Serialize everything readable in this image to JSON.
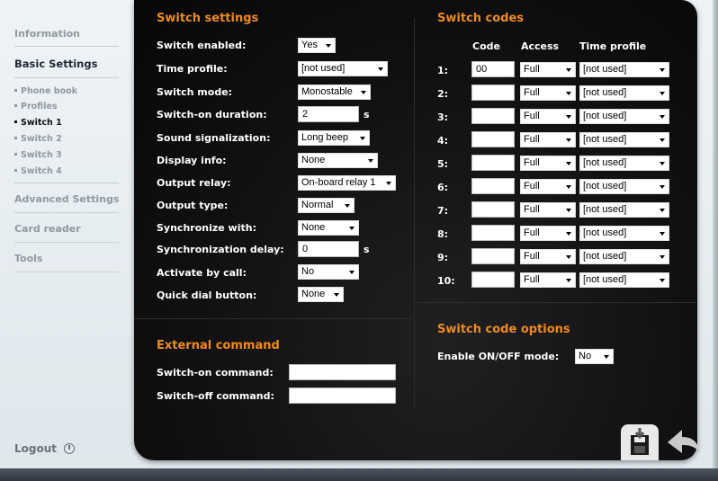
{
  "sidebar": {
    "information": "Information",
    "basic_settings": "Basic Settings",
    "sub": [
      "Phone book",
      "Profiles",
      "Switch 1",
      "Switch 2",
      "Switch 3",
      "Switch 4"
    ],
    "advanced": "Advanced Settings",
    "card_reader": "Card reader",
    "tools": "Tools",
    "logout": "Logout"
  },
  "switch_settings": {
    "title": "Switch settings",
    "enabled": {
      "label": "Switch enabled:",
      "value": "Yes"
    },
    "time_profile": {
      "label": "Time profile:",
      "value": "[not used]"
    },
    "mode": {
      "label": "Switch mode:",
      "value": "Monostable"
    },
    "duration": {
      "label": "Switch-on duration:",
      "value": "2",
      "unit": "s"
    },
    "sound": {
      "label": "Sound signalization:",
      "value": "Long beep"
    },
    "display": {
      "label": "Display info:",
      "value": "None"
    },
    "relay": {
      "label": "Output relay:",
      "value": "On-board relay 1"
    },
    "output_type": {
      "label": "Output type:",
      "value": "Normal"
    },
    "sync_with": {
      "label": "Synchronize with:",
      "value": "None"
    },
    "sync_delay": {
      "label": "Synchronization delay:",
      "value": "0",
      "unit": "s"
    },
    "activate_call": {
      "label": "Activate by call:",
      "value": "No"
    },
    "quick_dial": {
      "label": "Quick dial button:",
      "value": "None"
    }
  },
  "external_command": {
    "title": "External command",
    "on_label": "Switch-on command:",
    "on_value": "",
    "off_label": "Switch-off command:",
    "off_value": ""
  },
  "switch_codes": {
    "title": "Switch codes",
    "col_code": "Code",
    "col_access": "Access",
    "col_profile": "Time profile",
    "rows": [
      {
        "num": "1:",
        "code": "00",
        "access": "Full",
        "profile": "[not used]"
      },
      {
        "num": "2:",
        "code": "",
        "access": "Full",
        "profile": "[not used]"
      },
      {
        "num": "3:",
        "code": "",
        "access": "Full",
        "profile": "[not used]"
      },
      {
        "num": "4:",
        "code": "",
        "access": "Full",
        "profile": "[not used]"
      },
      {
        "num": "5:",
        "code": "",
        "access": "Full",
        "profile": "[not used]"
      },
      {
        "num": "6:",
        "code": "",
        "access": "Full",
        "profile": "[not used]"
      },
      {
        "num": "7:",
        "code": "",
        "access": "Full",
        "profile": "[not used]"
      },
      {
        "num": "8:",
        "code": "",
        "access": "Full",
        "profile": "[not used]"
      },
      {
        "num": "9:",
        "code": "",
        "access": "Full",
        "profile": "[not used]"
      },
      {
        "num": "10:",
        "code": "",
        "access": "Full",
        "profile": "[not used]"
      }
    ]
  },
  "code_options": {
    "title": "Switch code options",
    "onoff_label": "Enable ON/OFF mode:",
    "onoff_value": "No"
  },
  "icons": {
    "save": "save-icon",
    "back": "back-arrow-icon",
    "logout": "power-icon"
  },
  "colors": {
    "accent": "#f08a1c",
    "panel": "#111113",
    "sidebar": "#e6edf1"
  }
}
